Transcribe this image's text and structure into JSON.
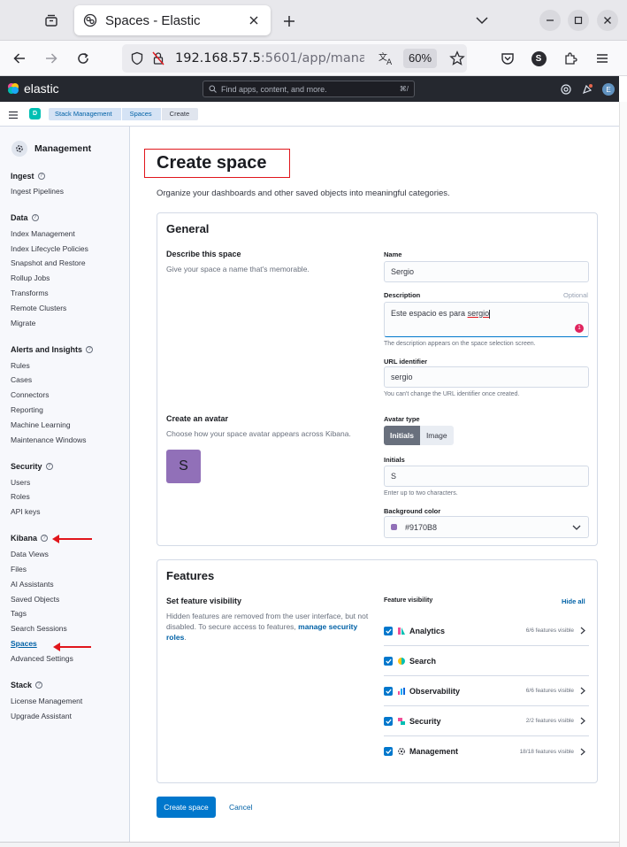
{
  "browser": {
    "tab_title": "Spaces - Elastic",
    "url_host": "192.168.57.5",
    "url_rest": ":5601/app/manag",
    "zoom": "60%",
    "profile_initial": "S"
  },
  "kibana": {
    "brand": "elastic",
    "search_placeholder": "Find apps, content, and more.",
    "search_shortcut": "⌘/",
    "user_initial": "E",
    "space_initial": "D",
    "breadcrumbs": [
      "Stack Management",
      "Spaces",
      "Create"
    ]
  },
  "sidebar": {
    "title": "Management",
    "sections": [
      {
        "title": "Ingest",
        "items": [
          "Ingest Pipelines"
        ]
      },
      {
        "title": "Data",
        "items": [
          "Index Management",
          "Index Lifecycle Policies",
          "Snapshot and Restore",
          "Rollup Jobs",
          "Transforms",
          "Remote Clusters",
          "Migrate"
        ]
      },
      {
        "title": "Alerts and Insights",
        "items": [
          "Rules",
          "Cases",
          "Connectors",
          "Reporting",
          "Machine Learning",
          "Maintenance Windows"
        ]
      },
      {
        "title": "Security",
        "items": [
          "Users",
          "Roles",
          "API keys"
        ]
      },
      {
        "title": "Kibana",
        "items": [
          "Data Views",
          "Files",
          "AI Assistants",
          "Saved Objects",
          "Tags",
          "Search Sessions",
          "Spaces",
          "Advanced Settings"
        ]
      },
      {
        "title": "Stack",
        "items": [
          "License Management",
          "Upgrade Assistant"
        ]
      }
    ],
    "help_glyph": "?"
  },
  "page": {
    "title": "Create space",
    "subtitle": "Organize your dashboards and other saved objects into meaningful categories.",
    "general": {
      "heading": "General",
      "describe_title": "Describe this space",
      "describe_desc": "Give your space a name that's memorable.",
      "name_label": "Name",
      "name_value": "Sergio",
      "description_label": "Description",
      "optional": "Optional",
      "description_value_pre": "Este espacio es para ",
      "description_value_word": "sergio",
      "description_help": "The description appears on the space selection screen.",
      "error_count": "1",
      "url_label": "URL identifier",
      "url_value": "sergio",
      "url_help": "You can't change the URL identifier once created.",
      "avatar_title": "Create an avatar",
      "avatar_desc": "Choose how your space avatar appears across Kibana.",
      "avatar_letter": "S",
      "avatar_type_label": "Avatar type",
      "avatar_type_options": [
        "Initials",
        "Image"
      ],
      "initials_label": "Initials",
      "initials_value": "S",
      "initials_help": "Enter up to two characters.",
      "bg_label": "Background color",
      "bg_value": "#9170B8",
      "bg_color": "#9170b8"
    },
    "features": {
      "heading": "Features",
      "set_title": "Set feature visibility",
      "set_desc": "Hidden features are removed from the user interface, but not disabled. To secure access to features, ",
      "set_link": "manage security roles",
      "set_end": ".",
      "visibility_label": "Feature visibility",
      "hide_all": "Hide all",
      "items": [
        {
          "name": "Analytics",
          "count": "6/6 features visible"
        },
        {
          "name": "Search",
          "count": ""
        },
        {
          "name": "Observability",
          "count": "6/6 features visible"
        },
        {
          "name": "Security",
          "count": "2/2 features visible"
        },
        {
          "name": "Management",
          "count": "18/18 features visible"
        }
      ]
    },
    "create_button": "Create space",
    "cancel_button": "Cancel"
  },
  "colors": {
    "primary": "#0077cc",
    "annotation_red": "#e1161c",
    "avatar": "#9170b8"
  }
}
